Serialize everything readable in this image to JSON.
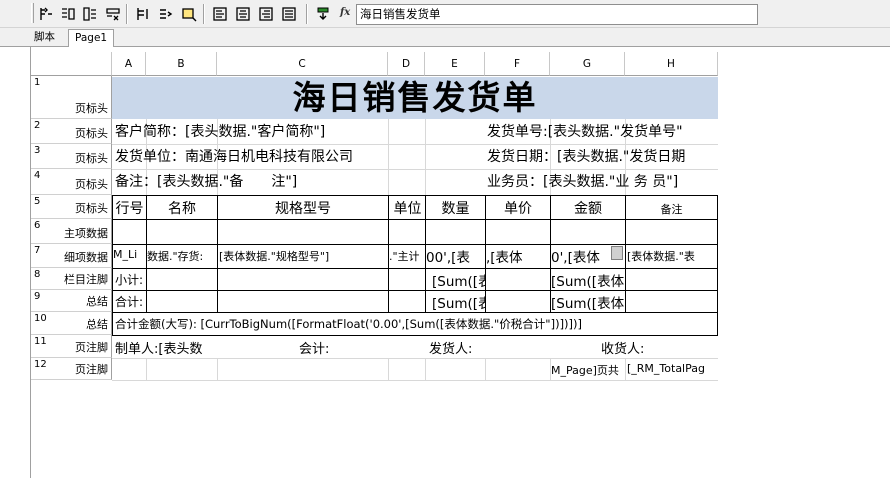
{
  "toolbar": {
    "buttons": [
      "insert-row-icon",
      "insert-column-icon",
      "insert-cells-icon",
      "delete-cells-icon",
      "merge-cells-icon",
      "split-cells-icon",
      "group-icon",
      "align-left-icon",
      "align-center-icon",
      "align-right-icon",
      "align-justify-icon",
      "insert-field-icon"
    ],
    "formula_value": "海日销售发货单"
  },
  "tabs": [
    "脚本",
    "Page1"
  ],
  "columns": [
    "A",
    "B",
    "C",
    "D",
    "E",
    "F",
    "G",
    "H"
  ],
  "rows": [
    {
      "num": "1",
      "label": "页标头"
    },
    {
      "num": "2",
      "label": "页标头"
    },
    {
      "num": "3",
      "label": "页标头"
    },
    {
      "num": "4",
      "label": "页标头"
    },
    {
      "num": "5",
      "label": "页标头"
    },
    {
      "num": "6",
      "label": "主项数据"
    },
    {
      "num": "7",
      "label": "细项数据"
    },
    {
      "num": "8",
      "label": "栏目注脚"
    },
    {
      "num": "9",
      "label": "总结"
    },
    {
      "num": "10",
      "label": "总结"
    },
    {
      "num": "11",
      "label": "页注脚"
    },
    {
      "num": "12",
      "label": "页注脚"
    }
  ],
  "report": {
    "title": "海日销售发货单",
    "r2_left": "客户简称：[表头数据.\"客户简称\"]",
    "r2_right": "发货单号:[表头数据.\"发货单号\"",
    "r3_left": "发货单位：南通海日机电科技有限公司",
    "r3_right": "发货日期：[表头数据.\"发货日期",
    "r4_left": "备注：[表头数据.\"备　　注\"]",
    "r4_right": "业务员：[表头数据.\"业 务 员\"]",
    "headers": [
      "行号",
      "名称",
      "规格型号",
      "单位",
      "数量",
      "单价",
      "金额",
      "备注"
    ],
    "r7": [
      "M_Li",
      "数据.\"存货:",
      "[表体数据.\"规格型号\"]",
      ".\"主计",
      "00',[表",
      ",[表体",
      "0',[表体",
      "[表体数据.\"表"
    ],
    "r8": {
      "a": "小计:",
      "e": "[Sum([表",
      "g": "[Sum([表体"
    },
    "r9": {
      "a": "合计:",
      "e": "[Sum([表",
      "g": "[Sum([表体"
    },
    "r10": "合计金额(大写): [CurrToBigNum([FormatFloat('0.00',[Sum([表体数据.\"价税合计\"])])])]",
    "r11": {
      "a": "制单人:[表头数",
      "c": "会计:",
      "e": "发货人:",
      "g": "收货人:"
    },
    "r12": {
      "g": "M_Page]页共",
      "h": "[_RM_TotalPag"
    }
  }
}
